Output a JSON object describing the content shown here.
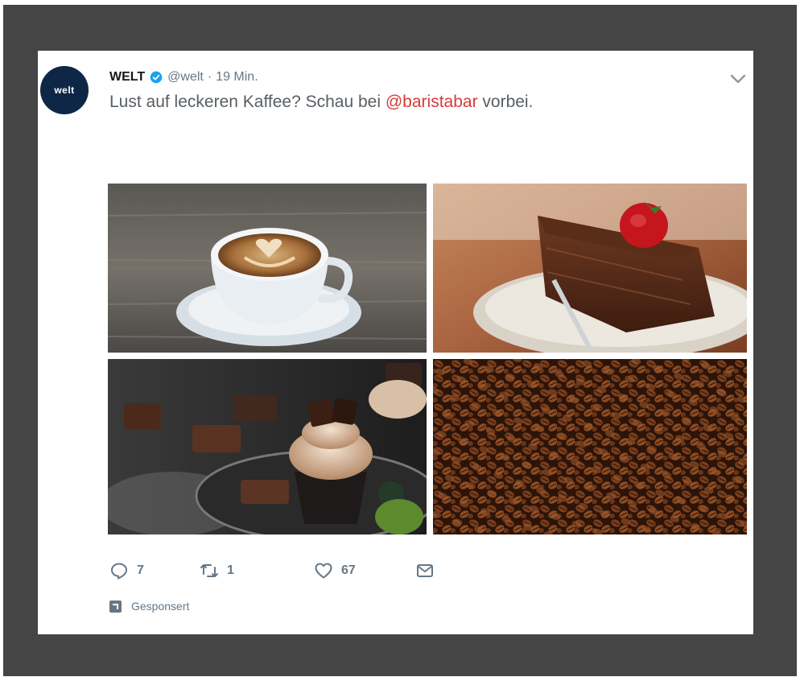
{
  "tweet": {
    "avatar_text": "WELT",
    "name": "WELT",
    "handle": "@welt",
    "separator": "·",
    "time": "19 Min.",
    "text_before": "Lust auf leckeren Kaffee? Schau bei ",
    "mention": "@baristabar",
    "text_after": " vorbei.",
    "mention_color": "#d63a3a",
    "verified_color": "#1da1f2"
  },
  "media": [
    {
      "subject": "latte art coffee cup"
    },
    {
      "subject": "chocolate cake with strawberry"
    },
    {
      "subject": "chocolate cupcake"
    },
    {
      "subject": "coffee beans"
    }
  ],
  "actions": {
    "reply_icon": "reply-icon",
    "reply_count": "7",
    "retweet_icon": "retweet-icon",
    "retweet_count": "1",
    "like_icon": "heart-icon",
    "like_count": "67",
    "dm_icon": "envelope-icon"
  },
  "promoted": {
    "label": "Gesponsert",
    "icon": "promoted-icon"
  }
}
